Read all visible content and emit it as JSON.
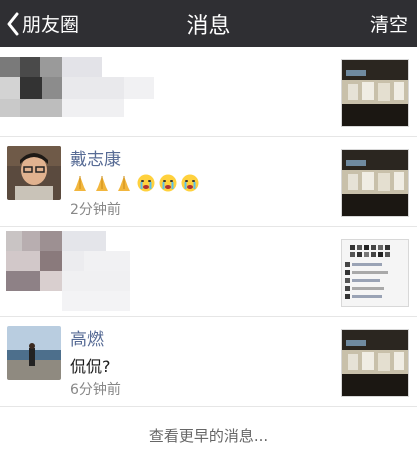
{
  "nav": {
    "back_label": "朋友圈",
    "title": "消息",
    "clear_label": "清空"
  },
  "messages": [
    {
      "name": "",
      "content": "",
      "time": "",
      "avatar": "blurred",
      "thumbnail": "photo"
    },
    {
      "name": "戴志康",
      "content_icons": [
        "pray-emoji",
        "pray-emoji",
        "pray-emoji",
        "crying-emoji",
        "crying-emoji",
        "crying-emoji"
      ],
      "time": "2分钟前",
      "avatar": "portrait",
      "thumbnail": "photo"
    },
    {
      "name": "",
      "content": "",
      "time": "",
      "avatar": "blurred",
      "thumbnail": "chat-screenshot"
    },
    {
      "name": "高燃",
      "content": "侃侃?",
      "time": "6分钟前",
      "avatar": "beach-photo",
      "thumbnail": "photo"
    }
  ],
  "footer": {
    "label": "查看更早的消息..."
  },
  "colors": {
    "navbar": "#2f2f33",
    "name": "#576b95",
    "time": "#888888"
  }
}
